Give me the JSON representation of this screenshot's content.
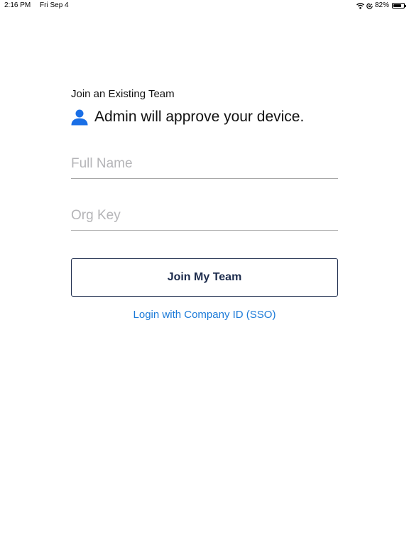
{
  "status_bar": {
    "time": "2:16 PM",
    "date": "Fri Sep 4",
    "battery_percent_label": "82%",
    "battery_level": 0.82
  },
  "join": {
    "section_title": "Join an Existing Team",
    "info_text": "Admin will approve your device.",
    "full_name": {
      "value": "",
      "placeholder": "Full Name"
    },
    "org_key": {
      "value": "",
      "placeholder": "Org Key"
    },
    "join_button_label": "Join My Team",
    "sso_link_label": "Login with Company ID (SSO)"
  },
  "colors": {
    "accent_blue": "#1b7ad8",
    "icon_blue": "#1a6fe6",
    "button_border": "#1c2b4c",
    "placeholder": "#b5b5b8"
  },
  "icons": {
    "wifi": "wifi-icon",
    "orientation_lock": "orientation-lock-icon",
    "battery": "battery-icon",
    "person": "person-icon"
  }
}
